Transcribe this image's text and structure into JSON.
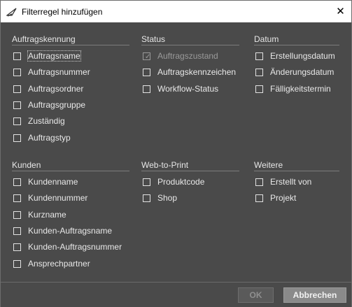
{
  "window": {
    "title": "Filterregel hinzufügen",
    "close_glyph": "✕"
  },
  "groups": {
    "auftragskennung": {
      "title": "Auftragskennung",
      "items": [
        {
          "label": "Auftragsname",
          "checked": false,
          "enabled": true
        },
        {
          "label": "Auftragsnummer",
          "checked": false,
          "enabled": true
        },
        {
          "label": "Auftragsordner",
          "checked": false,
          "enabled": true
        },
        {
          "label": "Auftragsgruppe",
          "checked": false,
          "enabled": true
        },
        {
          "label": "Zuständig",
          "checked": false,
          "enabled": true
        },
        {
          "label": "Auftragstyp",
          "checked": false,
          "enabled": true
        }
      ]
    },
    "status": {
      "title": "Status",
      "items": [
        {
          "label": "Auftragszustand",
          "checked": true,
          "enabled": false
        },
        {
          "label": "Auftragskennzeichen",
          "checked": false,
          "enabled": true
        },
        {
          "label": "Workflow-Status",
          "checked": false,
          "enabled": true
        }
      ]
    },
    "datum": {
      "title": "Datum",
      "items": [
        {
          "label": "Erstellungsdatum",
          "checked": false,
          "enabled": true
        },
        {
          "label": "Änderungsdatum",
          "checked": false,
          "enabled": true
        },
        {
          "label": "Fälligkeitstermin",
          "checked": false,
          "enabled": true
        }
      ]
    },
    "kunden": {
      "title": "Kunden",
      "items": [
        {
          "label": "Kundenname",
          "checked": false,
          "enabled": true
        },
        {
          "label": "Kundennummer",
          "checked": false,
          "enabled": true
        },
        {
          "label": "Kurzname",
          "checked": false,
          "enabled": true
        },
        {
          "label": "Kunden-Auftragsname",
          "checked": false,
          "enabled": true
        },
        {
          "label": "Kunden-Auftragsnummer",
          "checked": false,
          "enabled": true
        },
        {
          "label": "Ansprechpartner",
          "checked": false,
          "enabled": true
        }
      ]
    },
    "web_to_print": {
      "title": "Web-to-Print",
      "items": [
        {
          "label": "Produktcode",
          "checked": false,
          "enabled": true
        },
        {
          "label": "Shop",
          "checked": false,
          "enabled": true
        }
      ]
    },
    "weitere": {
      "title": "Weitere",
      "items": [
        {
          "label": "Erstellt von",
          "checked": false,
          "enabled": true
        },
        {
          "label": "Projekt",
          "checked": false,
          "enabled": true
        }
      ]
    }
  },
  "footer": {
    "ok_label": "OK",
    "cancel_label": "Abbrechen"
  },
  "colors": {
    "background": "#4a4a4a",
    "text": "#e8e8e8",
    "disabled": "#9a9a9a"
  }
}
